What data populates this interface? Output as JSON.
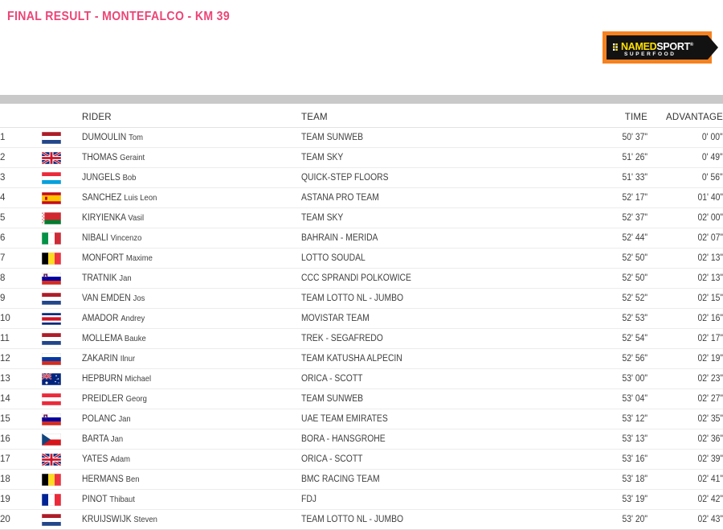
{
  "header": {
    "title": "FINAL RESULT - MONTEFALCO - KM 39"
  },
  "sponsor_logo": {
    "name_part": "NAMED",
    "sport_part": "SPORT",
    "registered_mark": "®",
    "tagline": "SUPERFOOD",
    "colors": {
      "border": "#f58220",
      "background": "#121212",
      "named_text": "#ffe100",
      "sport_text": "#ffffff"
    }
  },
  "colors": {
    "title_pink": "#ec4577",
    "grey_bar": "#c9c9c9",
    "row_divider": "#ececec",
    "text": "#3f3f3f"
  },
  "table": {
    "columns": {
      "rank": "",
      "flag": "",
      "rider": "RIDER",
      "team": "TEAM",
      "time": "TIME",
      "advantage": "ADVANTAGE"
    },
    "rows": [
      {
        "rank": "1",
        "flag": "nl",
        "country": "Netherlands",
        "surname": "DUMOULIN",
        "firstname": "Tom",
        "team": "TEAM SUNWEB",
        "time": "50' 37\"",
        "advantage": "0' 00\""
      },
      {
        "rank": "2",
        "flag": "gb",
        "country": "Great Britain",
        "surname": "THOMAS",
        "firstname": "Geraint",
        "team": "TEAM SKY",
        "time": "51' 26\"",
        "advantage": "0' 49\""
      },
      {
        "rank": "3",
        "flag": "lu",
        "country": "Luxembourg",
        "surname": "JUNGELS",
        "firstname": "Bob",
        "team": "QUICK-STEP FLOORS",
        "time": "51' 33\"",
        "advantage": "0' 56\""
      },
      {
        "rank": "4",
        "flag": "es",
        "country": "Spain",
        "surname": "SANCHEZ",
        "firstname": "Luis Leon",
        "team": "ASTANA PRO TEAM",
        "time": "52' 17\"",
        "advantage": "01' 40\""
      },
      {
        "rank": "5",
        "flag": "by",
        "country": "Belarus",
        "surname": "KIRYIENKA",
        "firstname": "Vasil",
        "team": "TEAM SKY",
        "time": "52' 37\"",
        "advantage": "02' 00\""
      },
      {
        "rank": "6",
        "flag": "it",
        "country": "Italy",
        "surname": "NIBALI",
        "firstname": "Vincenzo",
        "team": "BAHRAIN - MERIDA",
        "time": "52' 44\"",
        "advantage": "02' 07\""
      },
      {
        "rank": "7",
        "flag": "be",
        "country": "Belgium",
        "surname": "MONFORT",
        "firstname": "Maxime",
        "team": "LOTTO SOUDAL",
        "time": "52' 50\"",
        "advantage": "02' 13\""
      },
      {
        "rank": "8",
        "flag": "si",
        "country": "Slovenia",
        "surname": "TRATNIK",
        "firstname": "Jan",
        "team": "CCC SPRANDI POLKOWICE",
        "time": "52' 50\"",
        "advantage": "02' 13\""
      },
      {
        "rank": "9",
        "flag": "nl",
        "country": "Netherlands",
        "surname": "VAN EMDEN",
        "firstname": "Jos",
        "team": "TEAM LOTTO NL - JUMBO",
        "time": "52' 52\"",
        "advantage": "02' 15\""
      },
      {
        "rank": "10",
        "flag": "cr",
        "country": "Costa Rica",
        "surname": "AMADOR",
        "firstname": "Andrey",
        "team": "MOVISTAR TEAM",
        "time": "52' 53\"",
        "advantage": "02' 16\""
      },
      {
        "rank": "11",
        "flag": "nl",
        "country": "Netherlands",
        "surname": "MOLLEMA",
        "firstname": "Bauke",
        "team": "TREK - SEGAFREDO",
        "time": "52' 54\"",
        "advantage": "02' 17\""
      },
      {
        "rank": "12",
        "flag": "ru",
        "country": "Russia",
        "surname": "ZAKARIN",
        "firstname": "Ilnur",
        "team": "TEAM KATUSHA ALPECIN",
        "time": "52' 56\"",
        "advantage": "02' 19\""
      },
      {
        "rank": "13",
        "flag": "au",
        "country": "Australia",
        "surname": "HEPBURN",
        "firstname": "Michael",
        "team": "ORICA - SCOTT",
        "time": "53' 00\"",
        "advantage": "02' 23\""
      },
      {
        "rank": "14",
        "flag": "at",
        "country": "Austria",
        "surname": "PREIDLER",
        "firstname": "Georg",
        "team": "TEAM SUNWEB",
        "time": "53' 04\"",
        "advantage": "02' 27\""
      },
      {
        "rank": "15",
        "flag": "si",
        "country": "Slovenia",
        "surname": "POLANC",
        "firstname": "Jan",
        "team": "UAE TEAM EMIRATES",
        "time": "53' 12\"",
        "advantage": "02' 35\""
      },
      {
        "rank": "16",
        "flag": "cz",
        "country": "Czech Republic",
        "surname": "BARTA",
        "firstname": "Jan",
        "team": "BORA - HANSGROHE",
        "time": "53' 13\"",
        "advantage": "02' 36\""
      },
      {
        "rank": "17",
        "flag": "gb",
        "country": "Great Britain",
        "surname": "YATES",
        "firstname": "Adam",
        "team": "ORICA - SCOTT",
        "time": "53' 16\"",
        "advantage": "02' 39\""
      },
      {
        "rank": "18",
        "flag": "be",
        "country": "Belgium",
        "surname": "HERMANS",
        "firstname": "Ben",
        "team": "BMC RACING TEAM",
        "time": "53' 18\"",
        "advantage": "02' 41\""
      },
      {
        "rank": "19",
        "flag": "fr",
        "country": "France",
        "surname": "PINOT",
        "firstname": "Thibaut",
        "team": "FDJ",
        "time": "53' 19\"",
        "advantage": "02' 42\""
      },
      {
        "rank": "20",
        "flag": "nl",
        "country": "Netherlands",
        "surname": "KRUIJSWIJK",
        "firstname": "Steven",
        "team": "TEAM LOTTO NL - JUMBO",
        "time": "53' 20\"",
        "advantage": "02' 43\""
      }
    ]
  }
}
